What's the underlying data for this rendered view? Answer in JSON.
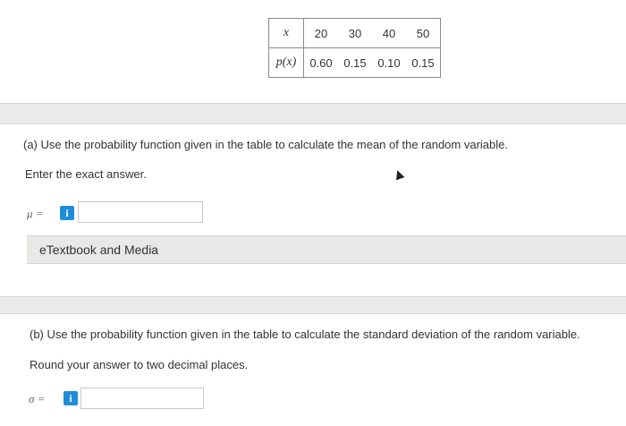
{
  "table": {
    "x_header": "x",
    "p_header": "p(x)",
    "x_values": [
      "20",
      "30",
      "40",
      "50"
    ],
    "p_values": [
      "0.60",
      "0.15",
      "0.10",
      "0.15"
    ]
  },
  "part_a": {
    "question": "(a) Use the probability function given in the table to calculate the mean of the random variable.",
    "instruction": "Enter the exact answer.",
    "symbol": "μ =",
    "info_label": "i",
    "answer_value": "",
    "media_label": "eTextbook and Media"
  },
  "part_b": {
    "question": "(b) Use the probability function given in the table to calculate the standard deviation of the random variable.",
    "instruction": "Round your answer to two decimal places.",
    "symbol": "σ =",
    "info_label": "i",
    "answer_value": ""
  },
  "colors": {
    "info_button": "#1f8ed8",
    "background": "#ebebea",
    "panel": "#ffffff"
  }
}
